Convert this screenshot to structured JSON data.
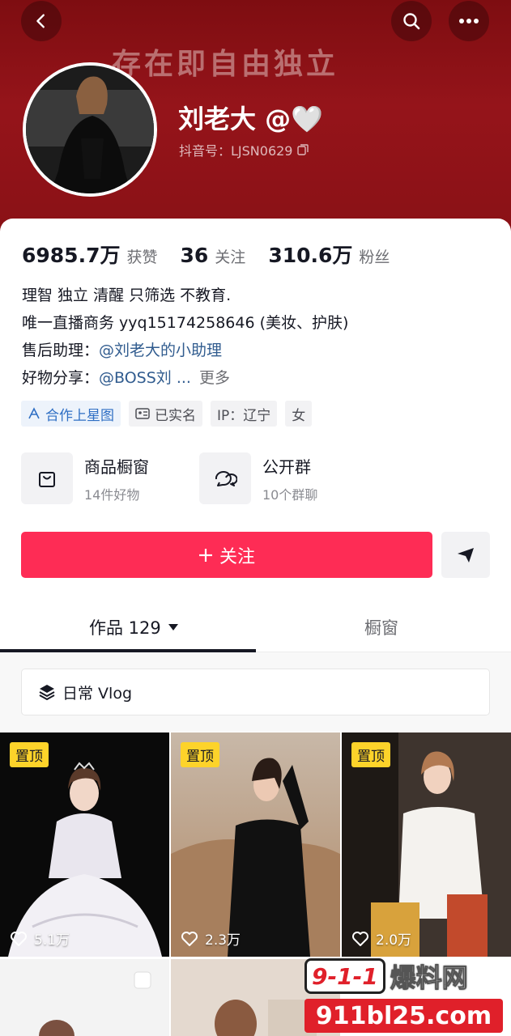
{
  "banner": {
    "text": "存在即自由独立"
  },
  "profile": {
    "nickname": "刘老大 @🤍",
    "douyin_id": "抖音号：LJSN0629"
  },
  "stats": [
    {
      "num": "6985.7万",
      "label": "获赞"
    },
    {
      "num": "36",
      "label": "关注"
    },
    {
      "num": "310.6万",
      "label": "粉丝"
    }
  ],
  "bio": {
    "line1": "理智 独立 清醒 只筛选 不教育.",
    "line2": "唯一直播商务 yyq15174258646 (美妆、护肤)",
    "line3_label": "售后助理：",
    "line3_link": "@刘老大的小助理",
    "line4_label": "好物分享：",
    "line4_link": "@BOSS刘 ...",
    "more": "更多"
  },
  "tags": {
    "star": "合作上星图",
    "verified": "已实名",
    "ip": "IP：辽宁",
    "gender": "女"
  },
  "entries": {
    "shop_title": "商品橱窗",
    "shop_sub": "14件好物",
    "group_title": "公开群",
    "group_sub": "10个群聊"
  },
  "follow_label": "关注",
  "tabs": {
    "works": "作品 129",
    "showcase": "橱窗"
  },
  "collection": "日常 Vlog",
  "videos": [
    {
      "pin": "置顶",
      "likes": "5.1万"
    },
    {
      "pin": "置顶",
      "likes": "2.3万"
    },
    {
      "pin": "置顶",
      "likes": "2.0万"
    }
  ],
  "watermark": {
    "top": "9-1-1",
    "cn": "爆料网",
    "domain": "911bl25.com"
  },
  "colors": {
    "banner": "#8a1116",
    "follow": "#fe2c55",
    "pin": "#fdd32a",
    "link": "#315c8f"
  }
}
